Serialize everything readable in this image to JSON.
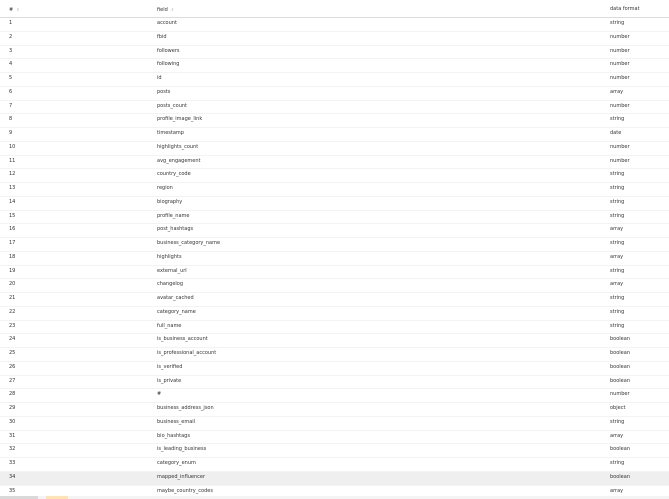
{
  "table": {
    "headers": {
      "index": "#",
      "field": "field",
      "data_format": "data format"
    },
    "sort_icon": "sort-arrows-icon",
    "highlighted_row": 33,
    "rows": [
      {
        "index": "1",
        "field": "account",
        "format": "string"
      },
      {
        "index": "2",
        "field": "fbid",
        "format": "number"
      },
      {
        "index": "3",
        "field": "followers",
        "format": "number"
      },
      {
        "index": "4",
        "field": "following",
        "format": "number"
      },
      {
        "index": "5",
        "field": "id",
        "format": "number"
      },
      {
        "index": "6",
        "field": "posts",
        "format": "array"
      },
      {
        "index": "7",
        "field": "posts_count",
        "format": "number"
      },
      {
        "index": "8",
        "field": "profile_image_link",
        "format": "string"
      },
      {
        "index": "9",
        "field": "timestamp",
        "format": "date"
      },
      {
        "index": "10",
        "field": "highlights_count",
        "format": "number"
      },
      {
        "index": "11",
        "field": "avg_engagement",
        "format": "number"
      },
      {
        "index": "12",
        "field": "country_code",
        "format": "string"
      },
      {
        "index": "13",
        "field": "region",
        "format": "string"
      },
      {
        "index": "14",
        "field": "biography",
        "format": "string"
      },
      {
        "index": "15",
        "field": "profile_name",
        "format": "string"
      },
      {
        "index": "16",
        "field": "post_hashtags",
        "format": "array"
      },
      {
        "index": "17",
        "field": "business_category_name",
        "format": "string"
      },
      {
        "index": "18",
        "field": "highlights",
        "format": "array"
      },
      {
        "index": "19",
        "field": "external_url",
        "format": "string"
      },
      {
        "index": "20",
        "field": "changelog",
        "format": "array"
      },
      {
        "index": "21",
        "field": "avatar_cached",
        "format": "string"
      },
      {
        "index": "22",
        "field": "category_name",
        "format": "string"
      },
      {
        "index": "23",
        "field": "full_name",
        "format": "string"
      },
      {
        "index": "24",
        "field": "is_business_account",
        "format": "boolean"
      },
      {
        "index": "25",
        "field": "is_professional_account",
        "format": "boolean"
      },
      {
        "index": "26",
        "field": "is_verified",
        "format": "boolean"
      },
      {
        "index": "27",
        "field": "is_private",
        "format": "boolean"
      },
      {
        "index": "28",
        "field": "#",
        "format": "number"
      },
      {
        "index": "29",
        "field": "business_address_json",
        "format": "object"
      },
      {
        "index": "30",
        "field": "business_email",
        "format": "string"
      },
      {
        "index": "31",
        "field": "bio_hashtags",
        "format": "array"
      },
      {
        "index": "32",
        "field": "is_leading_business",
        "format": "boolean"
      },
      {
        "index": "33",
        "field": "category_enum",
        "format": "string"
      },
      {
        "index": "34",
        "field": "mapped_influencer",
        "format": "boolean"
      },
      {
        "index": "35",
        "field": "maybe_country_codes",
        "format": "array"
      }
    ]
  },
  "colors": {
    "highlight_row": "#efefef",
    "text": "#333333",
    "header_border": "#dcdcdc"
  }
}
